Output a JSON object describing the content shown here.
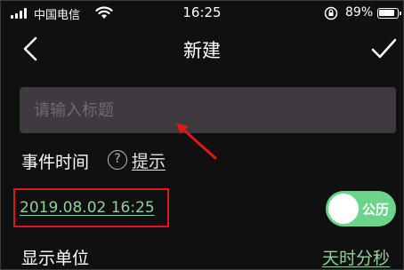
{
  "status_bar": {
    "carrier": "中国电信",
    "time": "16:25",
    "battery_percent_text": "89%",
    "battery_level": 0.89
  },
  "nav": {
    "title": "新建",
    "back_icon": "chevron-left-icon",
    "confirm_icon": "checkmark-icon"
  },
  "title_input": {
    "placeholder": "请输入标题",
    "value": ""
  },
  "event_time": {
    "label": "事件时间",
    "help_icon_text": "?",
    "hint_link": "提示",
    "date_value": "2019.08.02 16:25"
  },
  "calendar_toggle": {
    "label": "公历",
    "on": true
  },
  "display_unit": {
    "label": "显示单位",
    "value": "天时分秒"
  },
  "colors": {
    "background": "#101010",
    "input_bg": "#3e3a3f",
    "accent_green": "#8fd19a",
    "toggle_green": "#6cd48a",
    "annotation_red": "#e2161c"
  }
}
